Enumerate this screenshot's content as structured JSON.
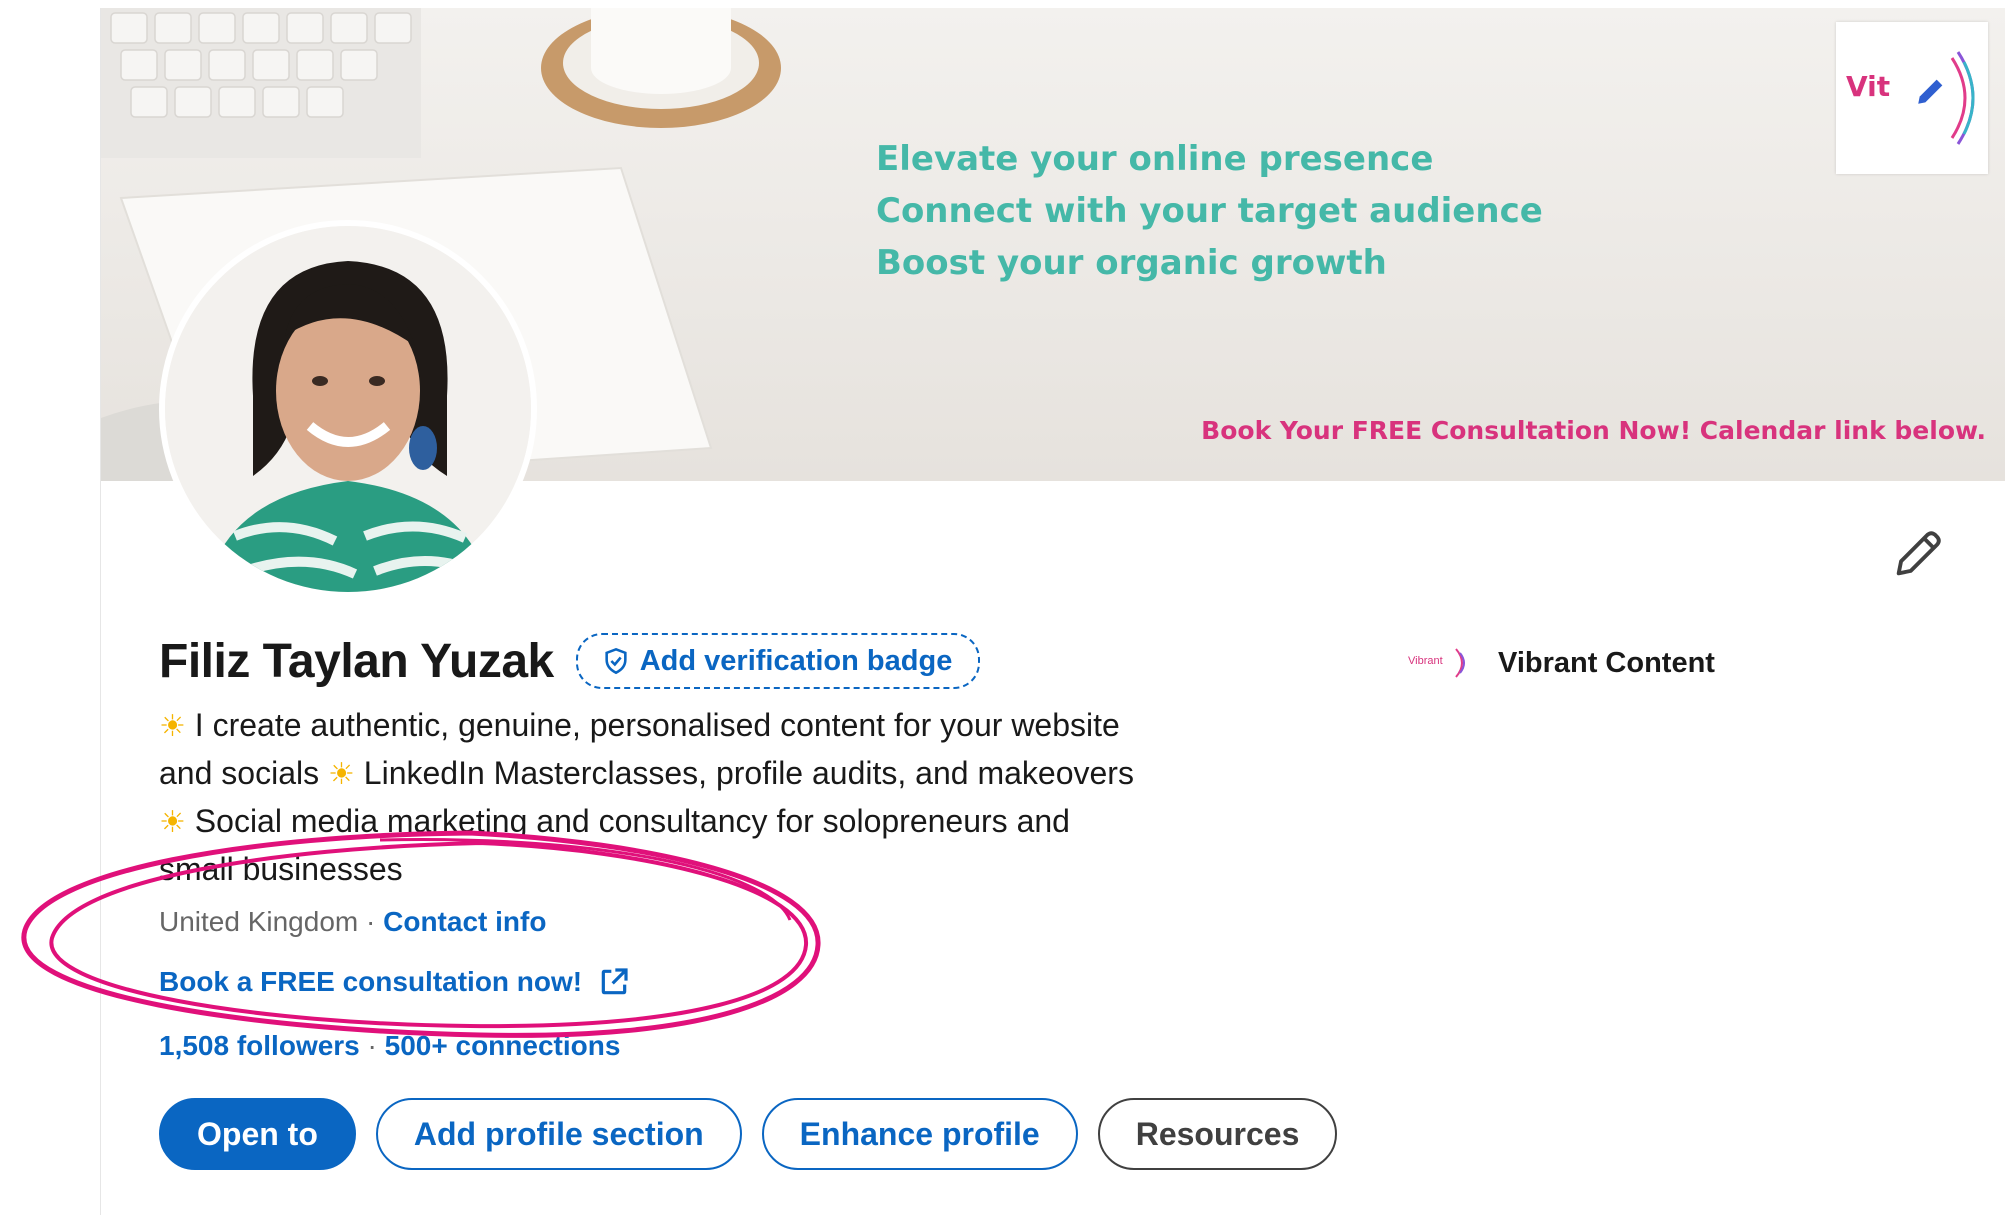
{
  "banner": {
    "taglines": [
      "Elevate your online presence",
      "Connect with your target audience",
      "Boost your organic growth"
    ],
    "cta": "Book Your FREE Consultation Now! Calendar link below.",
    "logo_text": "Vit"
  },
  "profile": {
    "name": "Filiz Taylan Yuzak",
    "verification_badge": "Add verification badge",
    "headline_lines": [
      "I create authentic, genuine, personalised content for your website",
      "and socials",
      "LinkedIn Masterclasses, profile audits, and makeovers",
      "Social media marketing and consultancy for solopreneurs and",
      "small businesses"
    ],
    "headline_emoji": "☀",
    "location": "United Kingdom",
    "location_separator": "·",
    "contact_info": "Contact info",
    "book_link": "Book a FREE consultation now!",
    "followers": "1,508 followers",
    "stats_separator": "·",
    "connections": "500+ connections"
  },
  "company": {
    "name": "Vibrant Content",
    "logo_text": "Vibrant"
  },
  "actions": {
    "open_to": "Open to",
    "add_profile_section": "Add profile section",
    "enhance_profile": "Enhance profile",
    "resources": "Resources"
  },
  "colors": {
    "linkedin_blue": "#0a66c2",
    "annotation_magenta": "#e0107a",
    "tagline_teal": "#45b8a8",
    "cta_pink": "#d8337d"
  },
  "icons": [
    "pencil-icon",
    "shield-check-icon",
    "external-link-icon"
  ]
}
